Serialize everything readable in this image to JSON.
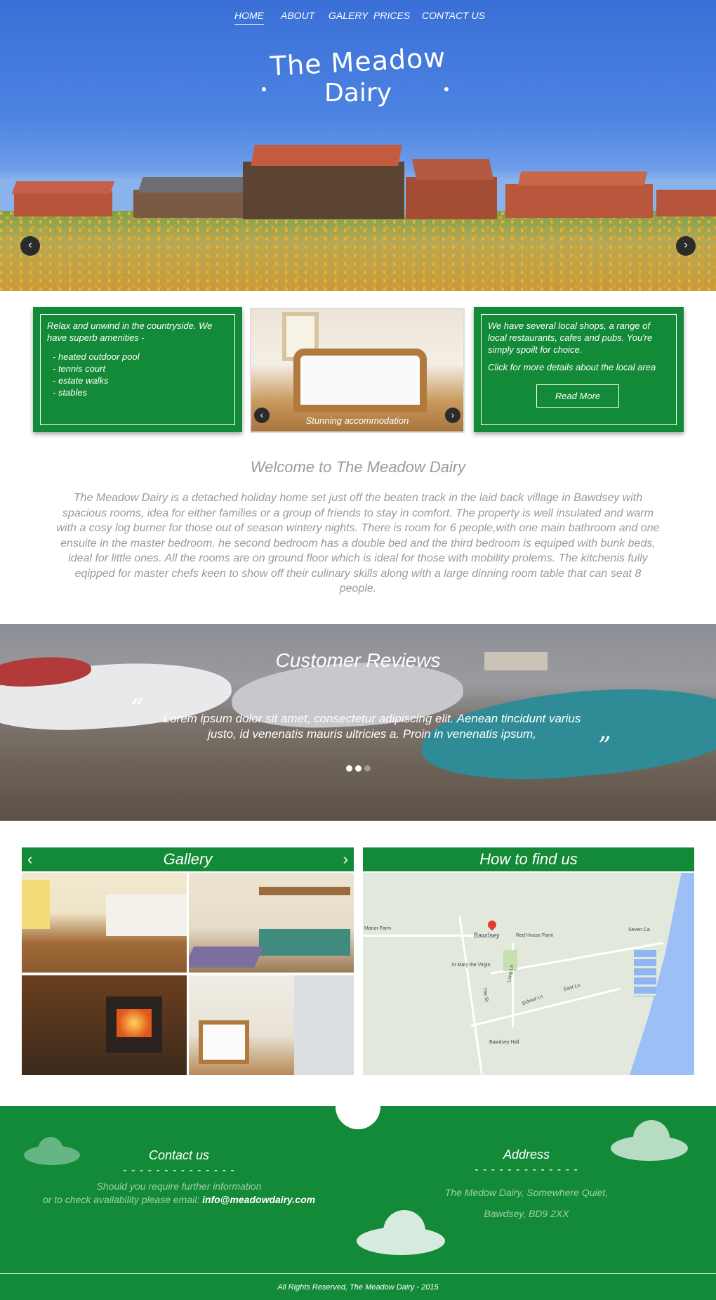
{
  "nav": {
    "items": [
      {
        "label": "HOME"
      },
      {
        "label": "ABOUT"
      },
      {
        "label": "GALERY"
      },
      {
        "label": "PRICES"
      },
      {
        "label": "CONTACT US"
      }
    ]
  },
  "hero": {
    "title_line1": "The Meadow",
    "title_line2": "Dairy",
    "prev_icon": "chevron-left-icon",
    "next_icon": "chevron-right-icon"
  },
  "features": {
    "amenities": {
      "intro": "Relax and unwind in the countryside. We have superb amenities -",
      "items": [
        "- heated outdoor pool",
        "- tennis court",
        "- estate walks",
        "- stables"
      ]
    },
    "slider_caption": "Stunning accommodation",
    "local": {
      "text": "We have several local shops, a range of local restaurants, cafes and pubs. You're simply spoilt for choice.",
      "cta_text": "Click for more details about the local area",
      "button_label": "Read More"
    }
  },
  "welcome": {
    "title": "Welcome to The Meadow Dairy",
    "body": "The Meadow Dairy is a detached holiday home set just off the beaten track in the laid back village in Bawdsey with spacious rooms, idea for either families or a group of friends to stay in comfort. The property is well insulated and warm with a cosy log burner for those out of season wintery nights. There is room for 6 people,with one main bathroom and one ensuite in the master bedroom.  he second bedroom has a double bed and the third bedroom is equiped with bunk beds, ideal for little ones. All the rooms are on ground floor which is ideal for those with mobility prolems. The kitchenis fully eqipped for master chefs keen to show off their culinary skills along with a large dinning room table that can seat 8 people."
  },
  "reviews": {
    "title": "Customer Reviews",
    "open_quote": "“",
    "close_quote": "”",
    "quote": "Lorem ipsum dolor sit amet, consectetur adipiscing elit. Aenean tincidunt varius justo, id venenatis mauris ultricies a. Proin in venenatis ipsum,",
    "slide_count": 3,
    "active_slide": 1
  },
  "gallery": {
    "title": "Gallery",
    "images": [
      "kitchen",
      "bunk-bedroom",
      "log-burner",
      "bedroom-ensuite"
    ]
  },
  "map": {
    "title": "How to find us",
    "labels": {
      "village": "Bawdsey",
      "manor": "Manor Farm",
      "red_house": "Red House Farm",
      "church": "St Mary the Virgin",
      "hall": "Bawdsey Hall",
      "seven": "Seven Ca",
      "the_st": "The St",
      "school": "School Ln",
      "long": "Long Ln",
      "east": "East Ln"
    }
  },
  "footer": {
    "contact": {
      "title": "Contact us",
      "divider": "- - - - - - - - - - - - - -",
      "line1": "Should you require further information",
      "line2": "or to check availability please email:",
      "email": "info@meadowdairy.com"
    },
    "address": {
      "title": "Address",
      "divider": "- - - - - - - - - - - - -",
      "line1": "The Medow Dairy, Somewhere Quiet,",
      "line2": "Bawdsey, BD9 2XX"
    },
    "copyright": "All Rights Reserved, The Meadow Dairy - 2015"
  },
  "colors": {
    "brand_green": "#138a37",
    "sky_blue": "#3a6fd6",
    "muted_text": "#9a9a9a",
    "map_water": "#9cc0f5"
  }
}
